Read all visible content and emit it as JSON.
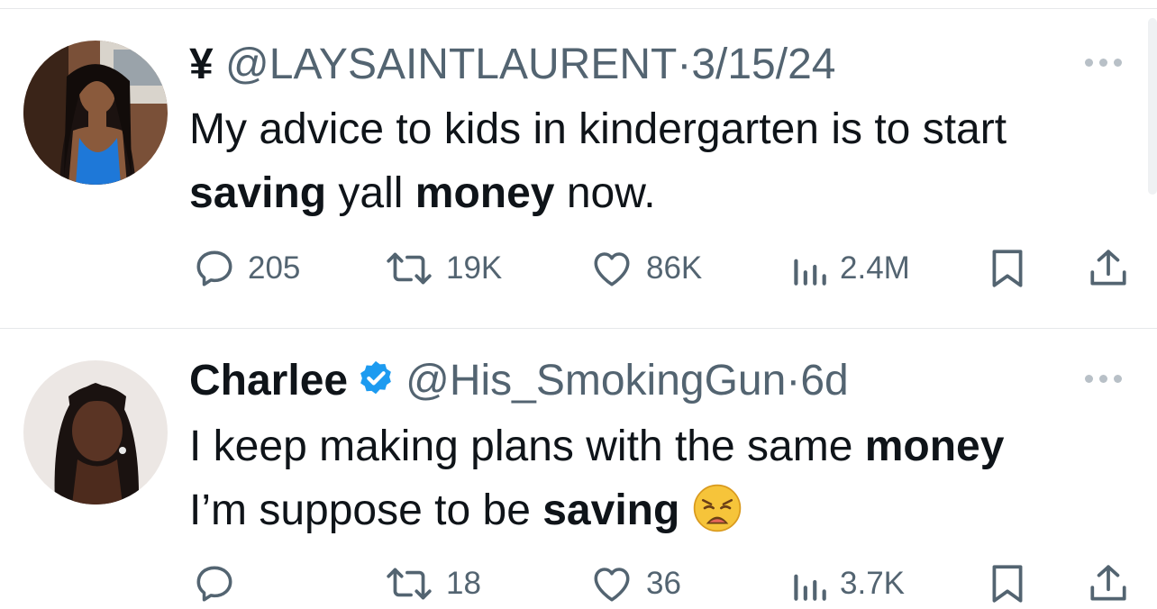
{
  "tweets": [
    {
      "display_name": "¥",
      "handle": "@LAYSAINTLAURENT",
      "separator": "·",
      "time": "3/15/24",
      "text": [
        {
          "t": "My advice to kids in kindergarten is to start "
        },
        {
          "t": "saving",
          "bold": true
        },
        {
          "t": " yall "
        },
        {
          "t": "money",
          "bold": true
        },
        {
          "t": " now."
        }
      ],
      "stats": {
        "replies": "205",
        "reposts": "19K",
        "likes": "86K",
        "views": "2.4M"
      },
      "verified": false,
      "avatar_icon": "avatar-photo",
      "more_icon": "more-icon"
    },
    {
      "display_name": "Charlee",
      "handle": "@His_SmokingGun",
      "separator": "·",
      "time": "6d",
      "text": [
        {
          "t": "I keep making plans with the same "
        },
        {
          "t": "money",
          "bold": true
        },
        {
          "t": " I’m suppose to be "
        },
        {
          "t": "saving",
          "bold": true
        }
      ],
      "emoji": "weary-face-emoji",
      "stats": {
        "replies": "",
        "reposts": "18",
        "likes": "36",
        "views": "3.7K"
      },
      "verified": true,
      "avatar_icon": "avatar-photo",
      "more_icon": "more-icon"
    }
  ],
  "colors": {
    "text": "#0f1419",
    "muted": "#536471",
    "verified_blue": "#1d9bf0",
    "divider": "#e6e8ea"
  }
}
